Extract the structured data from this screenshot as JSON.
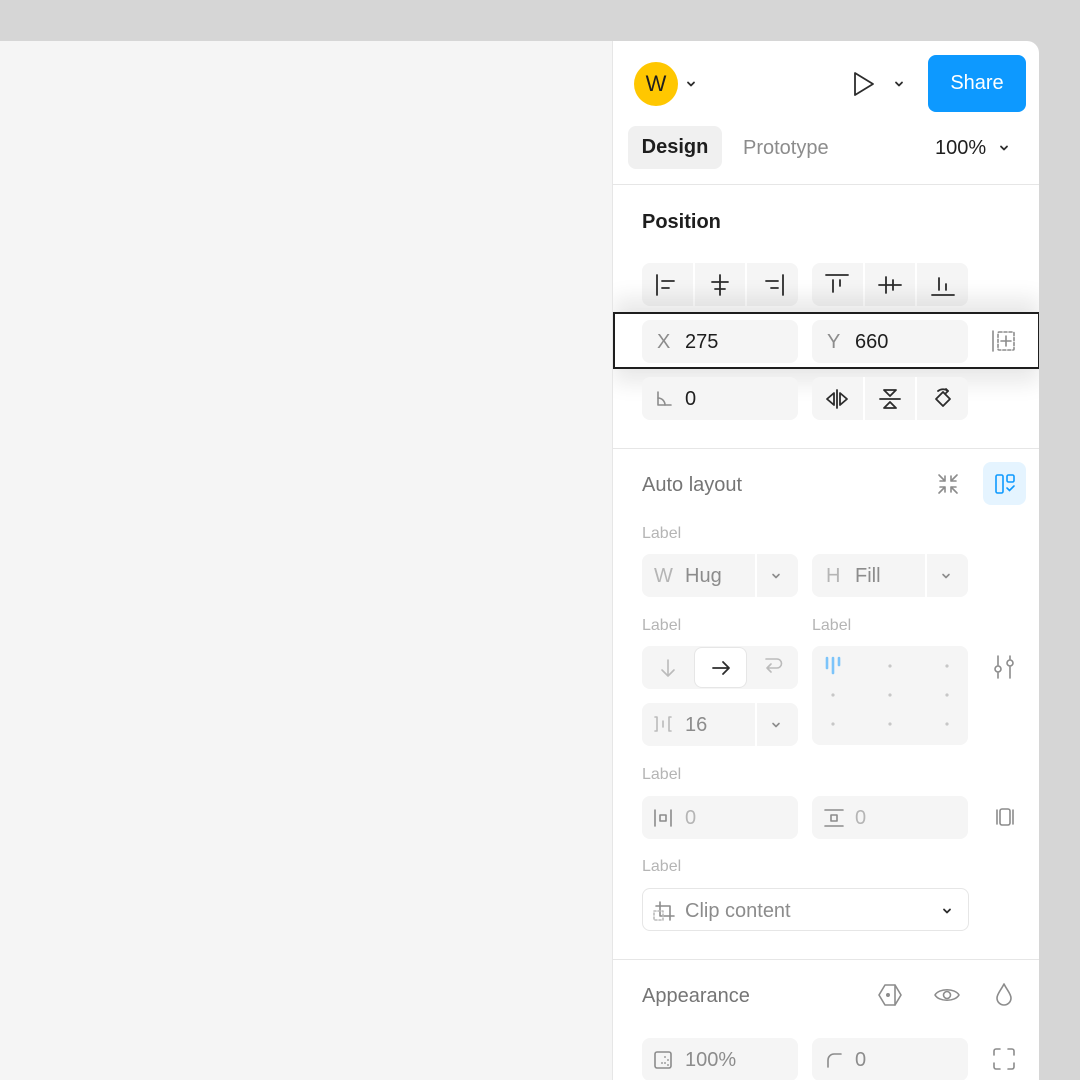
{
  "toolbar": {
    "avatar_initial": "W",
    "share_label": "Share",
    "accent_color": "#0d99ff"
  },
  "tabs": {
    "design": "Design",
    "prototype": "Prototype",
    "zoom": "100%"
  },
  "position": {
    "title": "Position",
    "x_label": "X",
    "x_value": "275",
    "y_label": "Y",
    "y_value": "660",
    "rotation_value": "0"
  },
  "auto_layout": {
    "title": "Auto layout",
    "label_size": "Label",
    "width_label": "W",
    "width_value": "Hug",
    "height_label": "H",
    "height_value": "Fill",
    "label_direction": "Label",
    "label_alignment": "Label",
    "gap_value": "16",
    "label_padding": "Label",
    "padding_h_value": "0",
    "padding_v_value": "0",
    "label_clip": "Label",
    "clip_content": "Clip content"
  },
  "appearance": {
    "title": "Appearance",
    "opacity_value": "100%",
    "radius_value": "0"
  },
  "icons": {
    "play": "play-icon",
    "chevron": "chevron-down-icon",
    "eye": "eye-icon",
    "drop": "drop-icon"
  }
}
